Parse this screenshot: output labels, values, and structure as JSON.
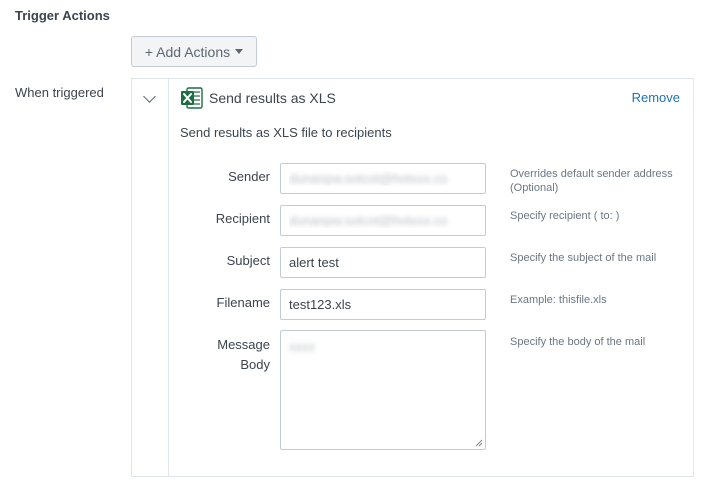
{
  "section": {
    "title": "Trigger Actions"
  },
  "toolbar": {
    "add_actions_label": "+ Add Actions"
  },
  "row": {
    "label": "When triggered"
  },
  "action": {
    "title": "Send results as XLS",
    "remove_label": "Remove",
    "description": "Send results as XLS file to recipients"
  },
  "fields": {
    "sender": {
      "label": "Sender",
      "value": "dunanpw.sotcot@hotxxx.co",
      "help": "Overrides default sender address (Optional)"
    },
    "recipient": {
      "label": "Recipient",
      "value": "dunanpw.sotcot@hotxxx.co",
      "help": "Specify recipient ( to: )"
    },
    "subject": {
      "label": "Subject",
      "value": "alert test",
      "help": "Specify the subject of the mail"
    },
    "filename": {
      "label": "Filename",
      "value": "test123.xls",
      "help": "Example: thisfile.xls"
    },
    "message_body": {
      "label_line1": "Message",
      "label_line2": "Body",
      "value": "xxxx",
      "help": "Specify the body of the mail"
    }
  },
  "colors": {
    "link": "#1e73b7",
    "excel_green": "#1d6f42"
  }
}
